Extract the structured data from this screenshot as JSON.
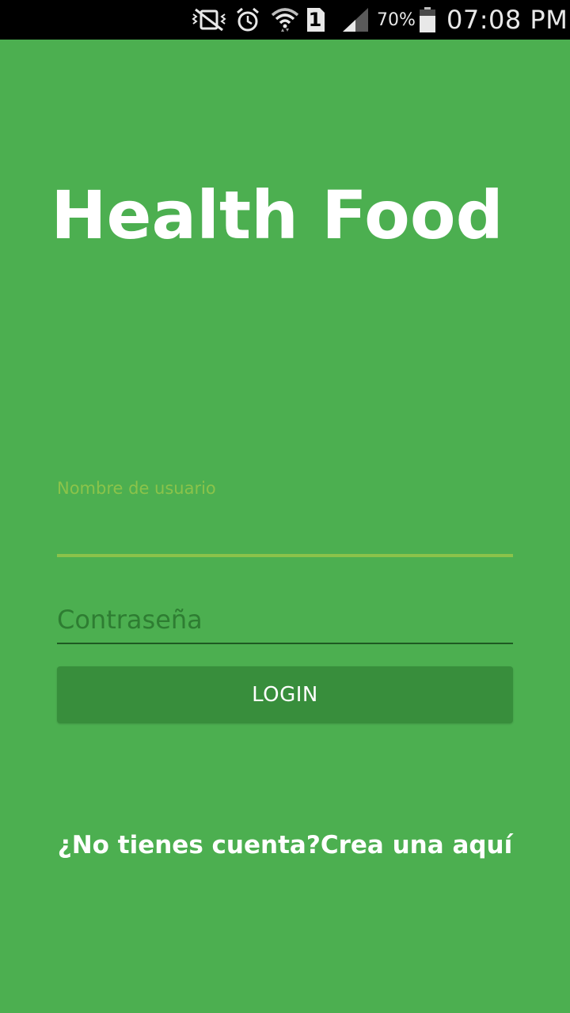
{
  "status_bar": {
    "battery_percent": "70%",
    "time": "07:08 PM",
    "sim_slot": "1",
    "icons": [
      "vibrate-mute-icon",
      "alarm-icon",
      "wifi-icon",
      "sim-icon",
      "signal-icon",
      "battery-icon"
    ]
  },
  "app": {
    "title": "Health Food"
  },
  "login_form": {
    "username_label": "Nombre de usuario",
    "username_value": "",
    "password_placeholder": "Contraseña",
    "password_value": "",
    "login_button_label": "LOGIN"
  },
  "signup": {
    "link_text": "¿No tienes cuenta?Crea una aquí"
  },
  "colors": {
    "background": "#4caf50",
    "accent": "#8bc34a",
    "button": "#388e3c",
    "status_bar": "#000000"
  }
}
